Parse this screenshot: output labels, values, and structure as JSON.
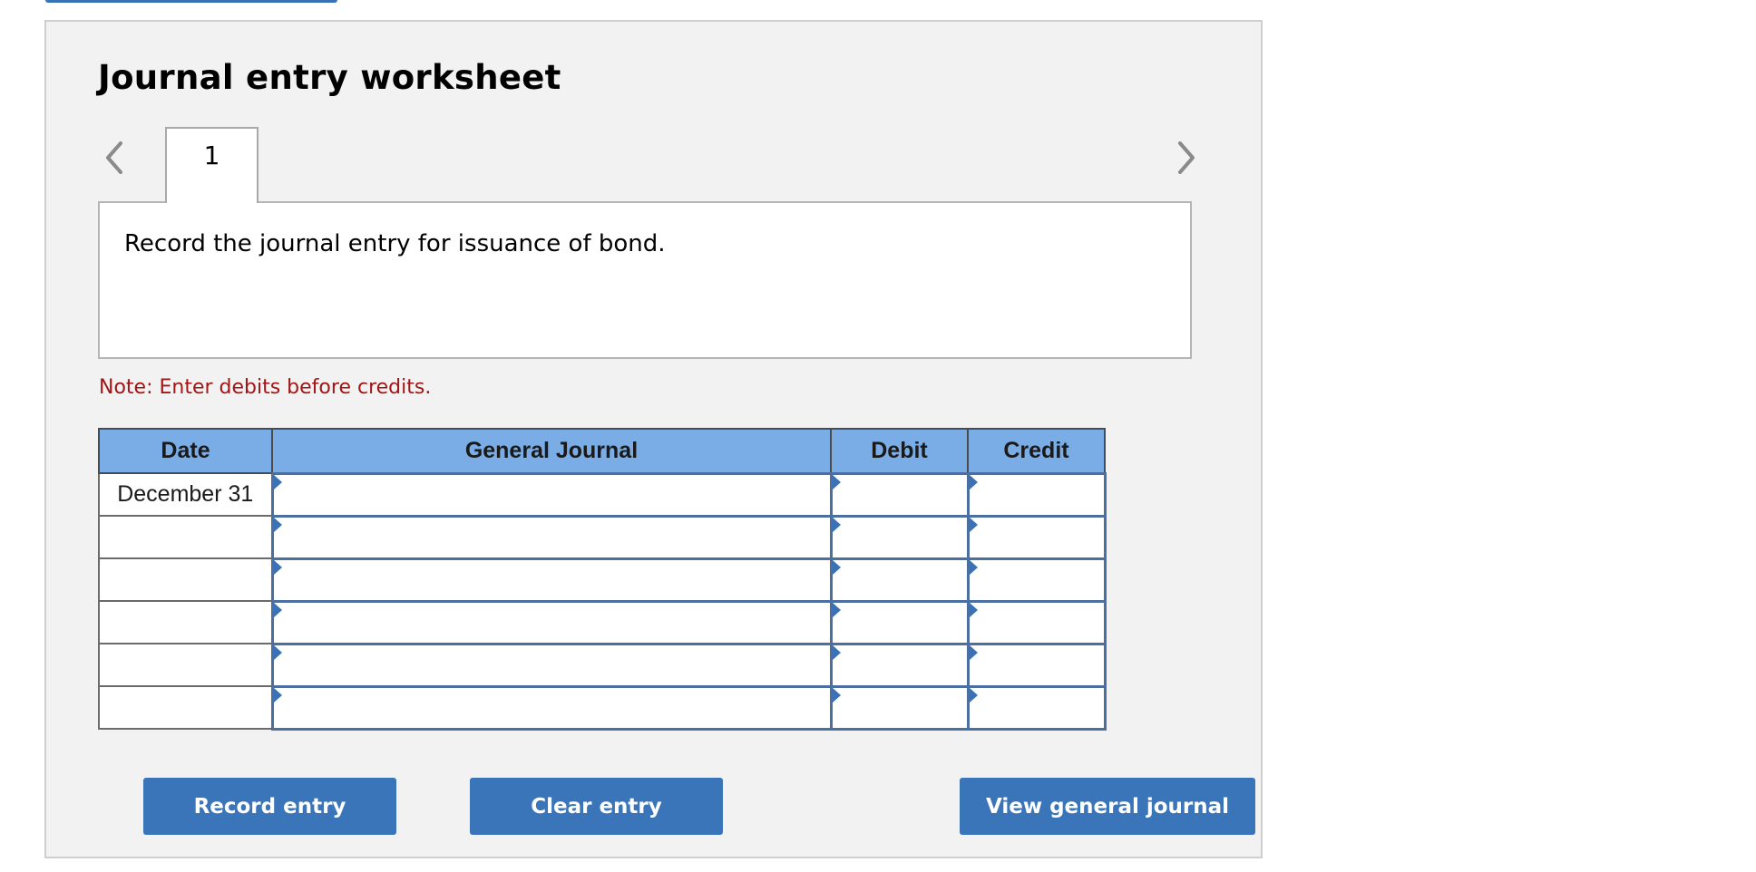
{
  "worksheet": {
    "title": "Journal entry worksheet",
    "tabs": [
      {
        "label": "1"
      }
    ],
    "question": "Record the journal entry for issuance of bond.",
    "note": "Note: Enter debits before credits."
  },
  "nav": {
    "prev_icon": "chevron-left-icon",
    "next_icon": "chevron-right-icon"
  },
  "table": {
    "headers": {
      "date": "Date",
      "general_journal": "General Journal",
      "debit": "Debit",
      "credit": "Credit"
    },
    "rows": [
      {
        "date": "December 31",
        "account": "",
        "debit": "",
        "credit": ""
      },
      {
        "date": "",
        "account": "",
        "debit": "",
        "credit": ""
      },
      {
        "date": "",
        "account": "",
        "debit": "",
        "credit": ""
      },
      {
        "date": "",
        "account": "",
        "debit": "",
        "credit": ""
      },
      {
        "date": "",
        "account": "",
        "debit": "",
        "credit": ""
      },
      {
        "date": "",
        "account": "",
        "debit": "",
        "credit": ""
      }
    ]
  },
  "buttons": {
    "record": "Record entry",
    "clear": "Clear entry",
    "view": "View general journal"
  },
  "colors": {
    "header_bg": "#7aade6",
    "button_bg": "#3a74b9",
    "note_text": "#a31515",
    "input_border": "#4a6fa0",
    "panel_bg": "#f2f2f2"
  }
}
